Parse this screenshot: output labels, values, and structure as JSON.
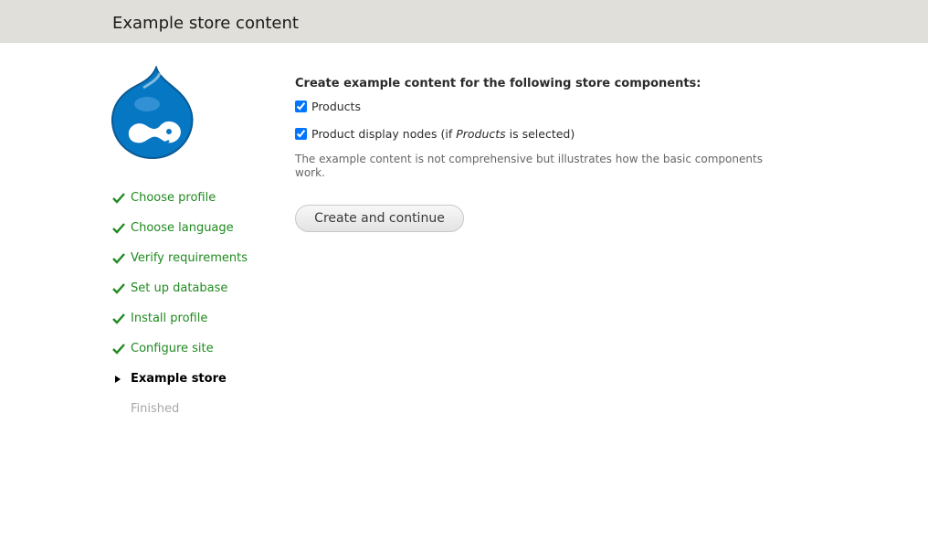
{
  "header": {
    "title": "Example store content"
  },
  "logo": {
    "icon": "drupal-drop-logo",
    "color": "#0677c3"
  },
  "steps": [
    {
      "label": "Choose profile",
      "status": "done"
    },
    {
      "label": "Choose language",
      "status": "done"
    },
    {
      "label": "Verify requirements",
      "status": "done"
    },
    {
      "label": "Set up database",
      "status": "done"
    },
    {
      "label": "Install profile",
      "status": "done"
    },
    {
      "label": "Configure site",
      "status": "done"
    },
    {
      "label": "Example store",
      "status": "active"
    },
    {
      "label": "Finished",
      "status": "pending"
    }
  ],
  "form": {
    "title": "Create example content for the following store components:",
    "checkboxes": [
      {
        "label": "Products",
        "checked": true
      },
      {
        "label_prefix": "Product display nodes (if ",
        "label_em": "Products",
        "label_suffix": " is selected)",
        "checked": true
      }
    ],
    "description": "The example content is not comprehensive but illustrates how the basic components work.",
    "submit_label": "Create and continue"
  },
  "colors": {
    "header_bg": "#e1dfd9",
    "done": "#208a20",
    "pending": "#a7a7a7"
  }
}
